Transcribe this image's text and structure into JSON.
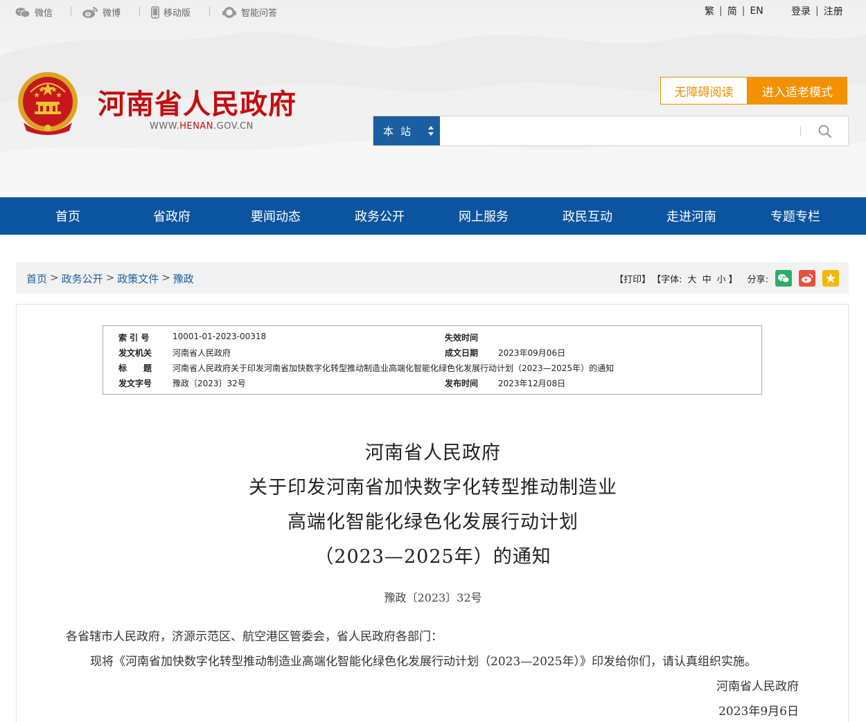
{
  "topbar": {
    "links": [
      "微信",
      "微博",
      "移动版",
      "智能问答"
    ],
    "lang": [
      "繁",
      "简",
      "EN"
    ],
    "account": [
      "登录",
      "注册"
    ]
  },
  "site": {
    "title": "河南省人民政府",
    "url_prefix": "WWW.",
    "url_highlight": "HENAN",
    "url_suffix": ".GOV.CN",
    "accessible_label": "无障碍阅读",
    "elder_label": "进入适老模式"
  },
  "search": {
    "scope": "本站",
    "placeholder": "",
    "icon": "search-icon"
  },
  "nav": [
    "首页",
    "省政府",
    "要闻动态",
    "政务公开",
    "网上服务",
    "政民互动",
    "走进河南",
    "专题专栏"
  ],
  "breadcrumb": [
    "首页",
    "政务公开",
    "政策文件",
    "豫政"
  ],
  "tools": {
    "print": "【打印】",
    "font_prefix": "【字体:",
    "font_sizes": [
      "大",
      "中",
      "小"
    ],
    "font_suffix": "】",
    "share_label": "分享:"
  },
  "meta": {
    "index_label": "索 引 号",
    "index_value": "10001-01-2023-00318",
    "expire_label": "失效时间",
    "expire_value": "",
    "issuer_label": "发文机关",
    "issuer_value": "河南省人民政府",
    "date_label": "成文日期",
    "date_value": "2023年09月06日",
    "title_label": "标　　题",
    "title_value": "河南省人民政府关于印发河南省加快数字化转型推动制造业高端化智能化绿色化发展行动计划（2023—2025年）的通知",
    "docno_label": "发文字号",
    "docno_value": "豫政〔2023〕32号",
    "publish_label": "发布时间",
    "publish_value": "2023年12月08日"
  },
  "document": {
    "title_lines": [
      "河南省人民政府",
      "关于印发河南省加快数字化转型推动制造业",
      "高端化智能化绿色化发展行动计划",
      "（2023—2025年）的通知"
    ],
    "doc_number": "豫政〔2023〕32号",
    "salutation": "各省辖市人民政府，济源示范区、航空港区管委会，省人民政府各部门：",
    "body": "现将《河南省加快数字化转型推动制造业高端化智能化绿色化发展行动计划（2023—2025年）》印发给你们，请认真组织实施。",
    "signature": "河南省人民政府",
    "sign_date": "2023年9月6日"
  },
  "colors": {
    "brand_red": "#c40d10",
    "nav_blue": "#0b54a0",
    "scope_blue": "#1a5fa1",
    "orange": "#f39100",
    "wechat_green": "#2aae67",
    "weibo_red": "#e6503d",
    "star_yellow": "#f5b800"
  }
}
